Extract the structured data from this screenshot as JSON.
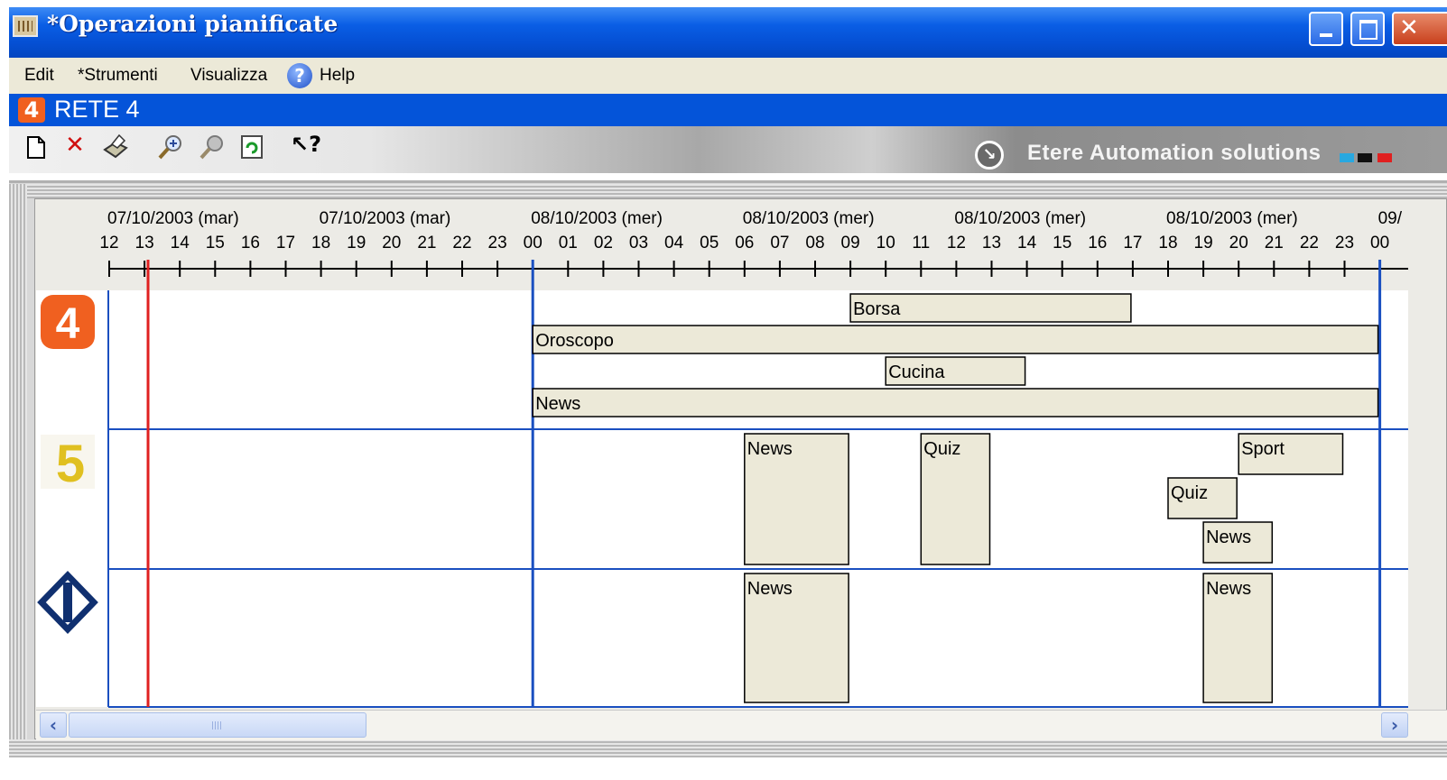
{
  "window": {
    "title": "*Operazioni pianificate"
  },
  "menu": {
    "items": [
      "Edit",
      "*Strumenti",
      "Visualizza",
      "Help"
    ]
  },
  "network": {
    "name": "RETE 4"
  },
  "toolbar": {
    "buttons": [
      "new-document-icon",
      "delete-icon",
      "print-icon",
      "zoom-in-icon",
      "zoom-out-icon",
      "refresh-icon",
      "context-help-icon"
    ],
    "brand": "Etere Automation solutions",
    "brand_colors": [
      "#28a8e0",
      "#101010",
      "#e02020"
    ]
  },
  "timeline": {
    "date_labels": [
      "07/10/2003 (mar)",
      "07/10/2003 (mar)",
      "08/10/2003 (mer)",
      "08/10/2003 (mer)",
      "08/10/2003 (mer)",
      "08/10/2003 (mer)",
      "09/"
    ],
    "hours": [
      "12",
      "13",
      "14",
      "15",
      "16",
      "17",
      "18",
      "19",
      "20",
      "21",
      "22",
      "23",
      "00",
      "01",
      "02",
      "03",
      "04",
      "05",
      "06",
      "07",
      "08",
      "09",
      "10",
      "11",
      "12",
      "13",
      "14",
      "15",
      "16",
      "17",
      "18",
      "19",
      "20",
      "21",
      "22",
      "23",
      "00"
    ],
    "current_time_hours": 1.1,
    "day_boundaries_hours": [
      12,
      36
    ],
    "accent_color": "#1a4fc0",
    "now_color": "#e02020",
    "block_fill": "#ece9d8"
  },
  "channels": [
    {
      "logo": "rete4-logo",
      "logo_color": "#f06020",
      "blocks": [
        {
          "label": "Borsa",
          "start": 21,
          "end": 29,
          "lane": 0
        },
        {
          "label": "Oroscopo",
          "start": 12,
          "end": 36,
          "lane": 1
        },
        {
          "label": "Cucina",
          "start": 22,
          "end": 26,
          "lane": 2
        },
        {
          "label": "News",
          "start": 12,
          "end": 36,
          "lane": 3
        }
      ]
    },
    {
      "logo": "canale5-logo",
      "logo_color": "#e0c020",
      "blocks": [
        {
          "label": "News",
          "start": 18,
          "end": 21,
          "lane": "full"
        },
        {
          "label": "Quiz",
          "start": 23,
          "end": 25,
          "lane": "full"
        },
        {
          "label": "Sport",
          "start": 32,
          "end": 35,
          "lane": 0
        },
        {
          "label": "Quiz",
          "start": 30,
          "end": 32,
          "lane": 1
        },
        {
          "label": "News",
          "start": 31,
          "end": 33,
          "lane": 2
        }
      ]
    },
    {
      "logo": "italia1-logo",
      "logo_color": "#103070",
      "blocks": [
        {
          "label": "News",
          "start": 18,
          "end": 21,
          "lane": "full"
        },
        {
          "label": "News",
          "start": 31,
          "end": 33,
          "lane": "full"
        }
      ]
    }
  ]
}
